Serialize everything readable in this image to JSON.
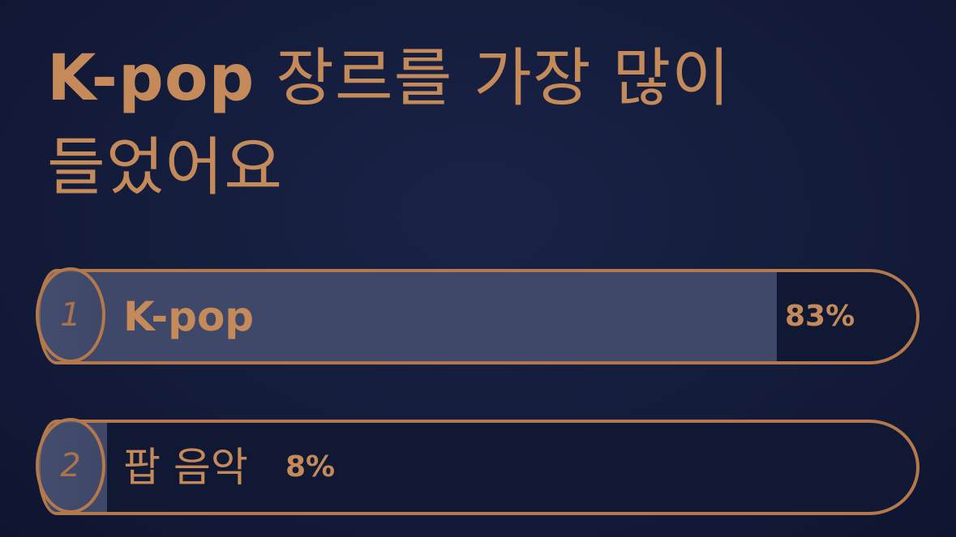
{
  "title": {
    "line1_strong": "K-pop",
    "line1_rest": " 장르를 가장 많이",
    "line2": "들었어요"
  },
  "colors": {
    "background": "#141c3b",
    "accent": "#c48a5a",
    "bar_fill": "#3f4868",
    "border": "#b3784b"
  },
  "ranking": [
    {
      "rank": "1",
      "label": "K-pop",
      "percent_text": "83%",
      "percent": 83
    },
    {
      "rank": "2",
      "label": "팝 음악",
      "percent_text": "8%",
      "percent": 8
    }
  ]
}
